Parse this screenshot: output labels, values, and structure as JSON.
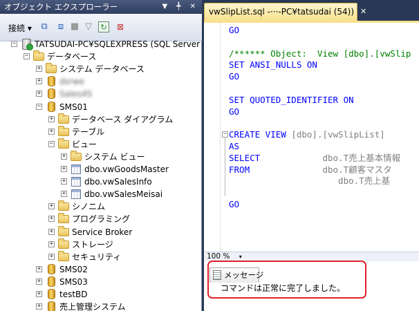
{
  "object_explorer": {
    "title": "オブジェクト エクスプローラー",
    "title_buttons": "▼ ╇ ✕",
    "toolbar": {
      "connect_label": "接続 ▾",
      "icons": [
        "connect-object-explorer-icon",
        "disconnect-icon",
        "stop-icon",
        "filter-icon",
        "refresh-icon",
        "sync-icon"
      ]
    },
    "tree": [
      {
        "label": "TATSUDAI-PC¥SQLEXPRESS (SQL Server",
        "expander": "−",
        "icon": "server-icon",
        "level": 0
      },
      {
        "label": "データベース",
        "expander": "−",
        "icon": "folder-icon",
        "level": 1
      },
      {
        "label": "システム データベース",
        "expander": "+",
        "icon": "folder-icon",
        "level": 2
      },
      {
        "label": "dsrwe",
        "expander": "+",
        "icon": "database-icon",
        "level": 2,
        "blurred": true
      },
      {
        "label": "Sales4S",
        "expander": "+",
        "icon": "database-icon",
        "level": 2,
        "blurred": true
      },
      {
        "label": "SMS01",
        "expander": "−",
        "icon": "database-icon",
        "level": 2
      },
      {
        "label": "データベース ダイアグラム",
        "expander": "+",
        "icon": "folder-icon",
        "level": 3
      },
      {
        "label": "テーブル",
        "expander": "+",
        "icon": "folder-icon",
        "level": 3
      },
      {
        "label": "ビュー",
        "expander": "−",
        "icon": "folder-icon",
        "level": 3
      },
      {
        "label": "システム ビュー",
        "expander": "+",
        "icon": "folder-icon",
        "level": 4
      },
      {
        "label": "dbo.vwGoodsMaster",
        "expander": "+",
        "icon": "view-icon",
        "level": 4
      },
      {
        "label": "dbo.vwSalesInfo",
        "expander": "+",
        "icon": "view-icon",
        "level": 4
      },
      {
        "label": "dbo.vwSalesMeisai",
        "expander": "+",
        "icon": "view-icon",
        "level": 4
      },
      {
        "label": "シノニム",
        "expander": "+",
        "icon": "folder-icon",
        "level": 3
      },
      {
        "label": "プログラミング",
        "expander": "+",
        "icon": "folder-icon",
        "level": 3
      },
      {
        "label": "Service Broker",
        "expander": "+",
        "icon": "folder-icon",
        "level": 3
      },
      {
        "label": "ストレージ",
        "expander": "+",
        "icon": "folder-icon",
        "level": 3
      },
      {
        "label": "セキュリティ",
        "expander": "+",
        "icon": "folder-icon",
        "level": 3
      },
      {
        "label": "SMS02",
        "expander": "+",
        "icon": "database-icon",
        "level": 2
      },
      {
        "label": "SMS03",
        "expander": "+",
        "icon": "database-icon",
        "level": 2
      },
      {
        "label": "testBD",
        "expander": "+",
        "icon": "database-icon",
        "level": 2
      },
      {
        "label": "売上管理システム",
        "expander": "+",
        "icon": "database-icon",
        "level": 2
      }
    ]
  },
  "editor": {
    "tab_title": "vwSlipList.sql -···-PC¥tatsudai (54))",
    "tab_close": "✕",
    "code_lines": [
      {
        "row": 0,
        "text": "GO",
        "style": "keyword"
      },
      {
        "row": 2,
        "text": "/****** Object:  View [dbo].[vwSlip",
        "style": "comment"
      },
      {
        "row": 3,
        "text": "SET ANSI_NULLS ON",
        "style": "keyword"
      },
      {
        "row": 4,
        "text": "GO",
        "style": "keyword"
      },
      {
        "row": 6,
        "text": "SET QUOTED_IDENTIFIER ON",
        "style": "keyword"
      },
      {
        "row": 7,
        "text": "GO",
        "style": "keyword"
      },
      {
        "row": 9,
        "text": "CREATE VIEW [dbo].[vwSlipList]",
        "style": "create"
      },
      {
        "row": 10,
        "text": "AS",
        "style": "keyword"
      },
      {
        "row": 11,
        "text": "SELECT            dbo.T売上基本情報",
        "style": "select"
      },
      {
        "row": 12,
        "text": "FROM              dbo.T顧客マスタ",
        "style": "select"
      },
      {
        "row": 13,
        "text": "                     dbo.T売上基",
        "style": "select"
      },
      {
        "row": 15,
        "text": "GO",
        "style": "keyword"
      }
    ],
    "collapse_symbol": "−",
    "zoom_label": "100 %",
    "zoom_arrow": "▾"
  },
  "results": {
    "tab_label": "メッセージ",
    "message": "コマンドは正常に完了しました。"
  },
  "colors": {
    "keyword": "#0000ff",
    "comment": "#008000",
    "identifier": "#808080",
    "highlight": "#e0202a"
  }
}
